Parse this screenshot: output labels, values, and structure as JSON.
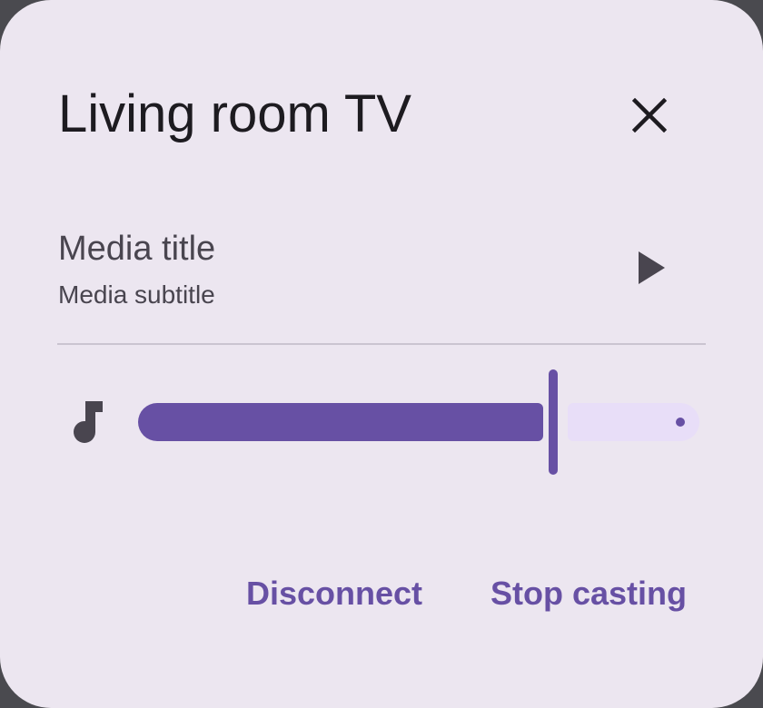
{
  "dialog": {
    "title": "Living room TV",
    "close_icon": "close-icon"
  },
  "media": {
    "title": "Media title",
    "subtitle": "Media subtitle",
    "play_icon": "play-icon"
  },
  "volume": {
    "icon": "music-note-icon",
    "level": 0.74
  },
  "actions": {
    "disconnect_label": "Disconnect",
    "stop_casting_label": "Stop casting"
  },
  "colors": {
    "surface": "#ece6f0",
    "primary": "#6750a4",
    "inactive_track": "#e8def8",
    "on_surface": "#1d1b20",
    "on_surface_variant": "#49454f",
    "outline_variant": "#cac4d0"
  }
}
